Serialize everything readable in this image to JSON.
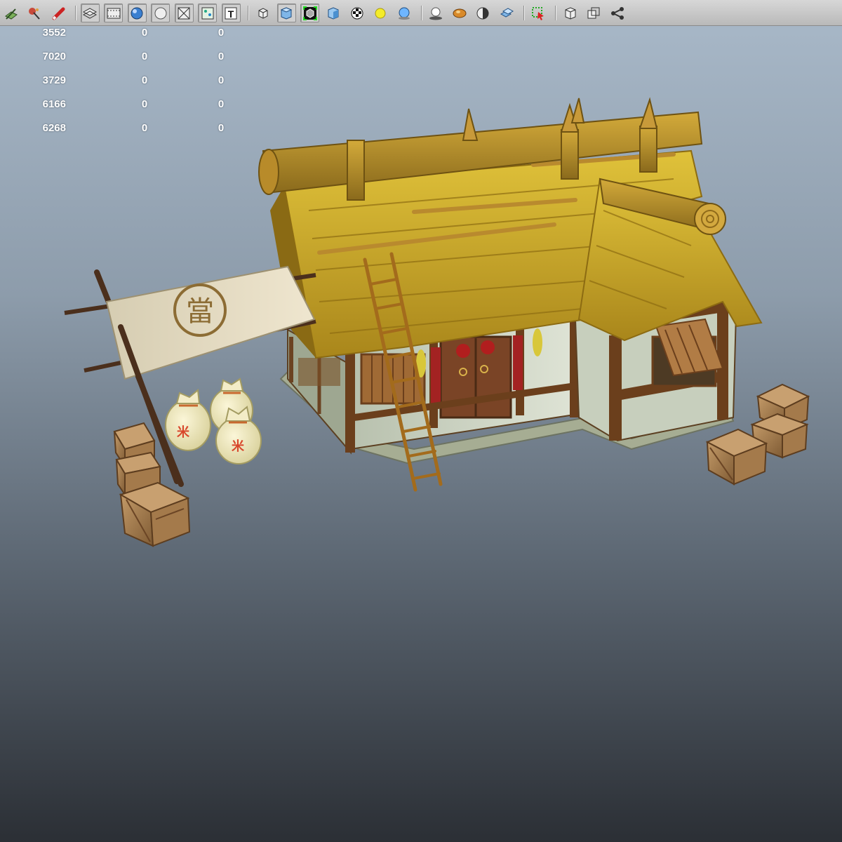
{
  "toolbar": {
    "groups": [
      [
        "snap-grid-icon",
        "paint-select-icon",
        "sculpt-brush-icon"
      ],
      [
        "wireframe-layers-icon",
        "film-gate-icon",
        "smooth-shade-icon",
        "flat-shade-icon",
        "xray-grid-icon",
        "texture-dots-icon",
        "text-overlay-icon"
      ],
      [
        "bounding-box-icon",
        "solid-cube-icon",
        "isolate-select-icon",
        "shaded-cube-icon",
        "checker-texture-icon",
        "default-light-icon",
        "all-lights-icon"
      ],
      [
        "shadows-icon",
        "ambient-occlusion-icon",
        "half-shade-icon",
        "multi-sample-icon"
      ],
      [
        "selection-highlight-icon"
      ],
      [
        "wire-cube-icon",
        "xray-joints-icon",
        "share-icon"
      ]
    ]
  },
  "hud": {
    "rows": [
      [
        "3552",
        "0",
        "0"
      ],
      [
        "7020",
        "0",
        "0"
      ],
      [
        "3729",
        "0",
        "0"
      ],
      [
        "6166",
        "0",
        "0"
      ],
      [
        "6268",
        "0",
        "0"
      ]
    ]
  },
  "scene": {
    "subject": "thatched-roof rice shop 3D model",
    "banner_glyph": "當",
    "sack_glyph": "米",
    "colors": {
      "thatch": "#c9a826",
      "wood": "#7a4a22",
      "plaster": "#cfd6c6",
      "stone": "#a6ad93",
      "door_red": "#a32222"
    }
  }
}
